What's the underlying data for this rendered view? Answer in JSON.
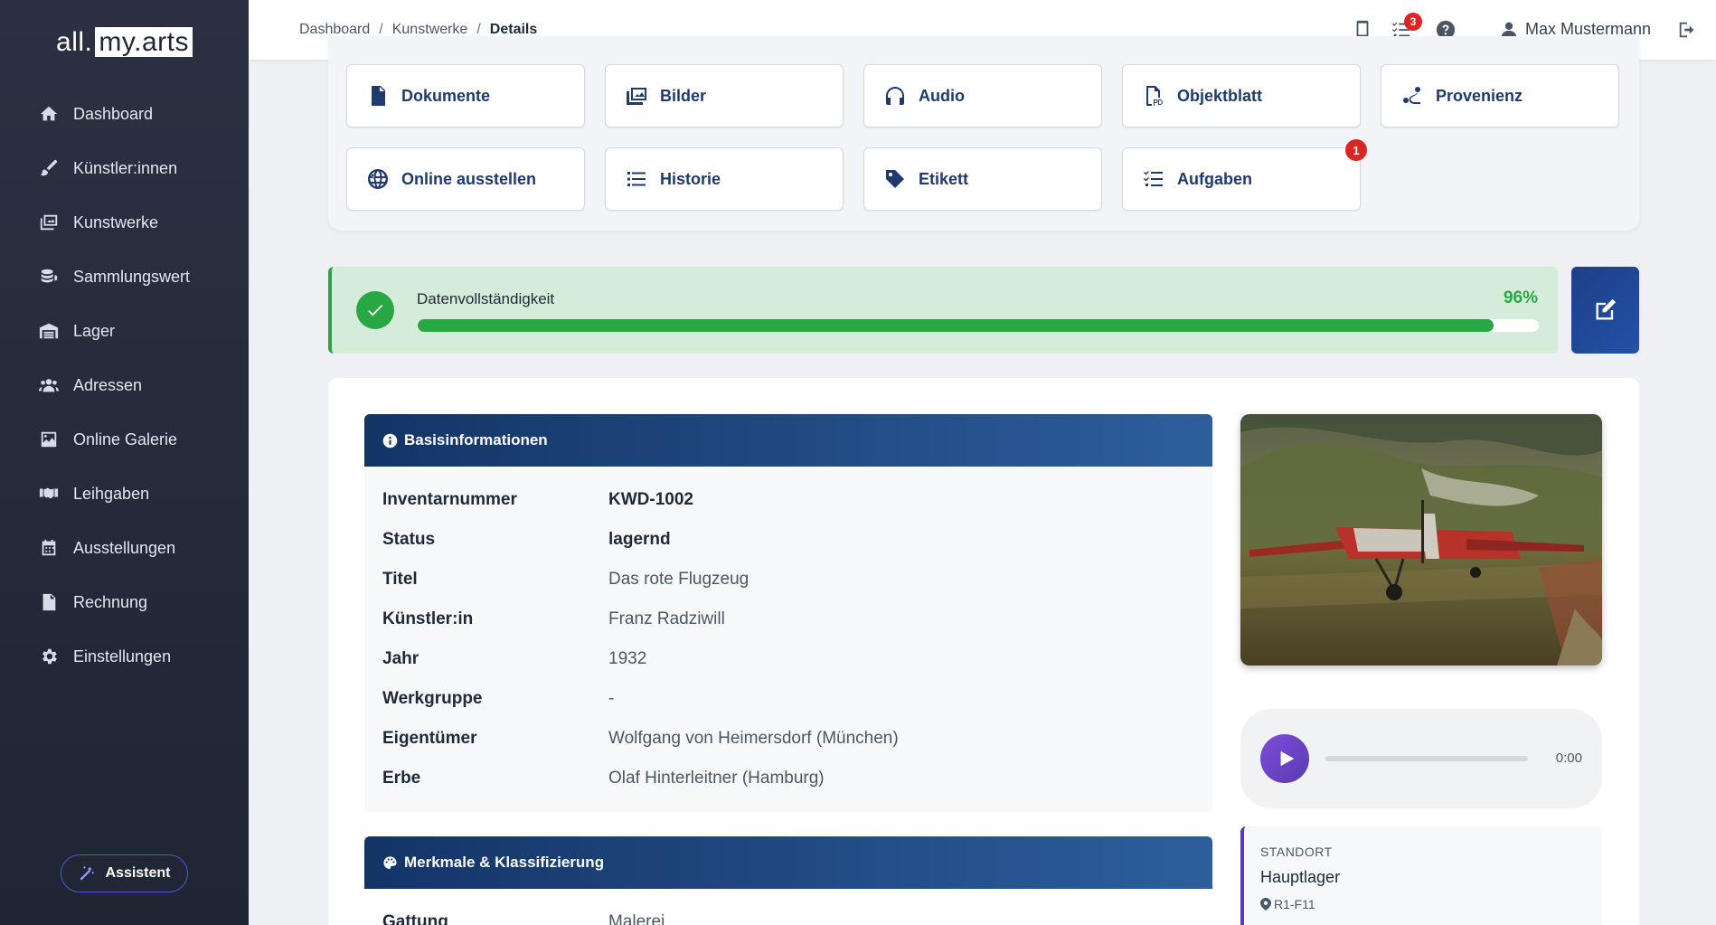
{
  "app": {
    "logo_left": "all.",
    "logo_box": "my.arts"
  },
  "sidebar": {
    "items": [
      {
        "label": "Dashboard",
        "icon": "home-icon"
      },
      {
        "label": "Künstler:innen",
        "icon": "brush-icon"
      },
      {
        "label": "Kunstwerke",
        "icon": "images-icon"
      },
      {
        "label": "Sammlungswert",
        "icon": "coins-icon"
      },
      {
        "label": "Lager",
        "icon": "warehouse-icon"
      },
      {
        "label": "Adressen",
        "icon": "users-icon"
      },
      {
        "label": "Online Galerie",
        "icon": "image-icon"
      },
      {
        "label": "Leihgaben",
        "icon": "handshake-icon"
      },
      {
        "label": "Ausstellungen",
        "icon": "calendar-icon"
      },
      {
        "label": "Rechnung",
        "icon": "invoice-icon"
      },
      {
        "label": "Einstellungen",
        "icon": "gear-icon"
      }
    ],
    "assistant_label": "Assistent"
  },
  "topbar": {
    "breadcrumb": [
      "Dashboard",
      "Kunstwerke",
      "Details"
    ],
    "separator": "/",
    "tasks_badge": "3",
    "user_name": "Max Mustermann"
  },
  "actions": [
    {
      "label": "Dokumente",
      "icon": "file-icon"
    },
    {
      "label": "Bilder",
      "icon": "images-icon"
    },
    {
      "label": "Audio",
      "icon": "headphones-icon"
    },
    {
      "label": "Objektblatt",
      "icon": "pdf-icon"
    },
    {
      "label": "Provenienz",
      "icon": "route-icon"
    },
    {
      "label": "Online ausstellen",
      "icon": "globe-icon"
    },
    {
      "label": "Historie",
      "icon": "list-icon"
    },
    {
      "label": "Etikett",
      "icon": "tag-icon"
    },
    {
      "label": "Aufgaben",
      "icon": "tasks-icon",
      "badge": "1"
    }
  ],
  "completeness": {
    "label": "Datenvollständigkeit",
    "percent_text": "96%",
    "fill_fraction": 0.96,
    "color": "#28a745"
  },
  "basis": {
    "title": "Basisinformationen",
    "rows": [
      {
        "key": "Inventarnummer",
        "value": "KWD-1002"
      },
      {
        "key": "Status",
        "value": "lagernd"
      },
      {
        "key": "Titel",
        "value": "Das rote Flugzeug"
      },
      {
        "key": "Künstler:in",
        "value": "Franz Radziwill"
      },
      {
        "key": "Jahr",
        "value": "1932"
      },
      {
        "key": "Werkgruppe",
        "value": "-"
      },
      {
        "key": "Eigentümer",
        "value": "Wolfgang von Heimersdorf (München)"
      },
      {
        "key": "Erbe",
        "value": "Olaf Hinterleitner (Hamburg)"
      }
    ]
  },
  "merkmale": {
    "title": "Merkmale & Klassifizierung",
    "rows": [
      {
        "key": "Gattung",
        "value": "Malerei"
      }
    ]
  },
  "audio": {
    "time": "0:00"
  },
  "standort": {
    "label": "STANDORT",
    "value": "Hauptlager",
    "position": "R1-F11"
  },
  "colors": {
    "sidebar_bg": "#262b3b",
    "header_gradient_start": "#143467",
    "header_gradient_end": "#2d5e9c",
    "accent_purple": "#5b3bb3",
    "success": "#28a745"
  }
}
